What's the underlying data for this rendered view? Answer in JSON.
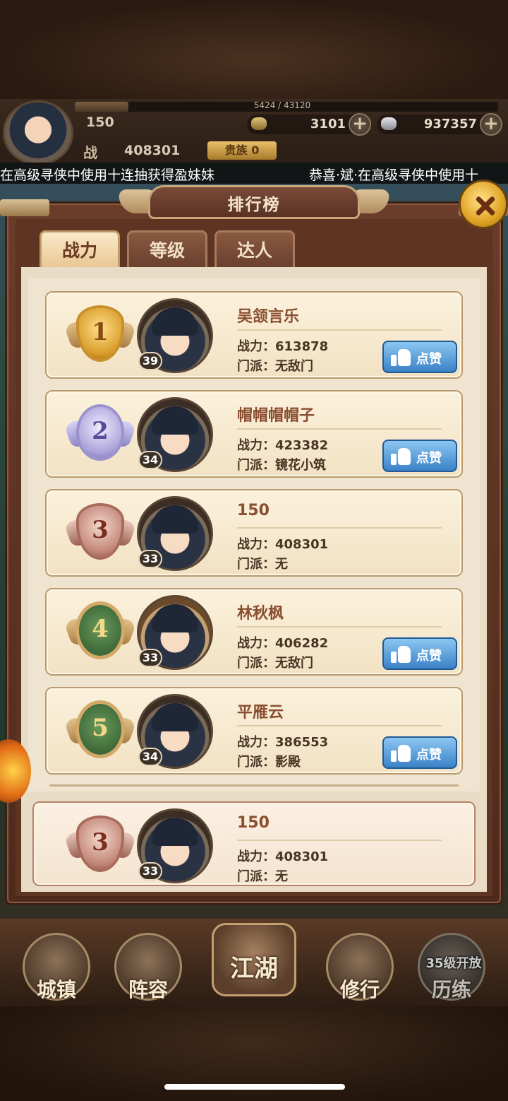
{
  "header": {
    "exp_text": "5424 / 43120",
    "exp_fraction": 0.126,
    "player_name": "150",
    "gold_value": "3101",
    "silver_value": "937357",
    "power_label": "战",
    "power_value": "408301",
    "noble_label": "贵族 0"
  },
  "marquee": {
    "left": {
      "p1": "在",
      "p2": "高级寻侠",
      "p3": "中使用十连抽获得",
      "p4": "盈妹妹"
    },
    "right": {
      "p1": "恭喜",
      "p2": "·斌·",
      "p3": "在",
      "p4": "高级寻侠",
      "p5": "中使用十"
    }
  },
  "panel": {
    "title": "排行榜",
    "tabs": [
      {
        "label": "战力",
        "active": true
      },
      {
        "label": "等级",
        "active": false
      },
      {
        "label": "达人",
        "active": false
      }
    ]
  },
  "rankings": [
    {
      "rank": "1",
      "level": "39",
      "name": "吴颔言乐",
      "power": "战力：613878",
      "sect": "门派：无敌门",
      "like": "点赞"
    },
    {
      "rank": "2",
      "level": "34",
      "name": "帽帽帽帽子",
      "power": "战力：423382",
      "sect": "门派：镜花小筑",
      "like": "点赞"
    },
    {
      "rank": "3",
      "level": "33",
      "name": "150",
      "power": "战力：408301",
      "sect": "门派：无"
    },
    {
      "rank": "4",
      "level": "33",
      "name": "林秋枫",
      "power": "战力：406282",
      "sect": "门派：无敌门",
      "like": "点赞"
    },
    {
      "rank": "5",
      "level": "34",
      "name": "平雁云",
      "power": "战力：386553",
      "sect": "门派：影殿",
      "like": "点赞"
    }
  ],
  "self": {
    "rank": "3",
    "level": "33",
    "name": "150",
    "power": "战力：408301",
    "sect": "门派：无"
  },
  "nav": {
    "town": "城镇",
    "lineup": "阵容",
    "jianghu": "江湖",
    "practice": "修行",
    "trial": "历练",
    "trial_lock": "35级开放"
  },
  "colors": {
    "accent_blue": "#3a82c8",
    "panel_brown": "#5e3422",
    "card_bg": "#f2e2c4",
    "marquee_red": "#e8483a",
    "marquee_orange": "#f4a23a"
  }
}
